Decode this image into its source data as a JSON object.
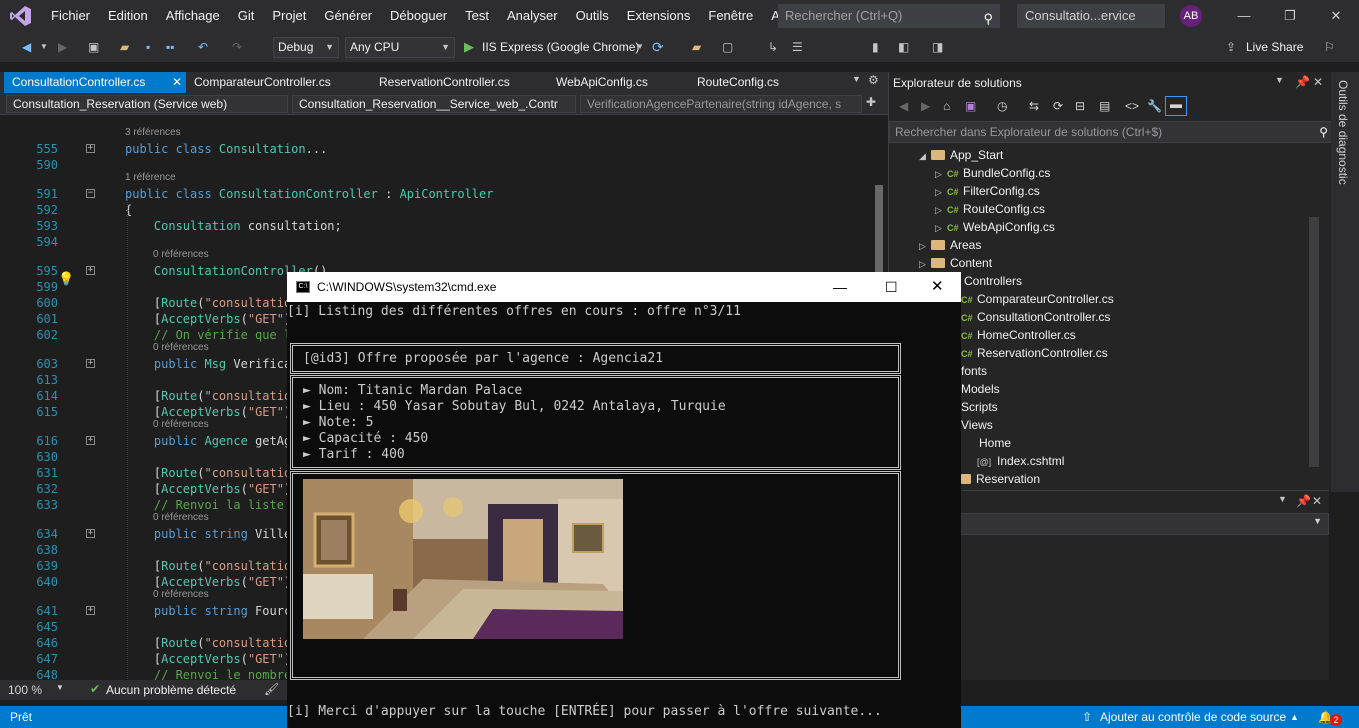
{
  "menubar": {
    "items": [
      "Fichier",
      "Edition",
      "Affichage",
      "Git",
      "Projet",
      "Générer",
      "Déboguer",
      "Test",
      "Analyser",
      "Outils",
      "Extensions",
      "Fenêtre",
      "Aide"
    ],
    "search_placeholder": "Rechercher (Ctrl+Q)",
    "window_title": "Consultatio...ervice web)",
    "avatar": "AB"
  },
  "toolbar": {
    "config": "Debug",
    "platform": "Any CPU",
    "run": "IIS Express (Google Chrome)",
    "live_share": "Live Share"
  },
  "tabs": [
    "ConsultationController.cs",
    "ComparateurController.cs",
    "ReservationController.cs",
    "WebApiConfig.cs",
    "RouteConfig.cs"
  ],
  "navbar": {
    "project": "Consultation_Reservation (Service web)",
    "class": "Consultation_Reservation__Service_web_.Contr",
    "member": "VerificationAgencePartenaire(string idAgence, s"
  },
  "editor": {
    "lines": [
      {
        "n": "555",
        "ref": "3 références",
        "code": [
          [
            "kw",
            "public class "
          ],
          [
            "ty",
            "Consultation"
          ],
          [
            "pl",
            "..."
          ]
        ]
      },
      {
        "n": "590",
        "code": []
      },
      {
        "n": "591",
        "ref": "1 référence",
        "code": [
          [
            "kw",
            "public class "
          ],
          [
            "ty",
            "ConsultationController"
          ],
          [
            "pl",
            " : "
          ],
          [
            "ty",
            "ApiController"
          ]
        ]
      },
      {
        "n": "592",
        "code": [
          [
            "pl",
            "{"
          ]
        ]
      },
      {
        "n": "593",
        "code": [
          [
            "pl",
            "    "
          ],
          [
            "ty",
            "Consultation"
          ],
          [
            "pl",
            " consultation;"
          ]
        ]
      },
      {
        "n": "594",
        "code": []
      },
      {
        "n": "595",
        "ref": "0 références",
        "code": [
          [
            "pl",
            "    "
          ],
          [
            "ty",
            "ConsultationController"
          ],
          [
            "pl",
            "()..."
          ]
        ]
      },
      {
        "n": "599",
        "code": []
      },
      {
        "n": "600",
        "code": [
          [
            "pl",
            "    ["
          ],
          [
            "ty",
            "Route"
          ],
          [
            "pl",
            "("
          ],
          [
            "st",
            "\"consultatio"
          ]
        ]
      },
      {
        "n": "601",
        "code": [
          [
            "pl",
            "    ["
          ],
          [
            "ty",
            "AcceptVerbs"
          ],
          [
            "pl",
            "("
          ],
          [
            "st",
            "\"GET\""
          ],
          [
            "pl",
            ")"
          ]
        ]
      },
      {
        "n": "602",
        "code": [
          [
            "cm",
            "    // On vérifie que l"
          ]
        ]
      },
      {
        "n": "603",
        "ref": "0 références",
        "code": [
          [
            "kw",
            "    public "
          ],
          [
            "ty",
            "Msg"
          ],
          [
            "pl",
            " Verificat"
          ]
        ]
      },
      {
        "n": "613",
        "code": []
      },
      {
        "n": "614",
        "code": [
          [
            "pl",
            "    ["
          ],
          [
            "ty",
            "Route"
          ],
          [
            "pl",
            "("
          ],
          [
            "st",
            "\"consultatio"
          ]
        ]
      },
      {
        "n": "615",
        "code": [
          [
            "pl",
            "    ["
          ],
          [
            "ty",
            "AcceptVerbs"
          ],
          [
            "pl",
            "("
          ],
          [
            "st",
            "\"GET\""
          ],
          [
            "pl",
            ")"
          ]
        ]
      },
      {
        "n": "616",
        "ref": "0 références",
        "code": [
          [
            "kw",
            "    public "
          ],
          [
            "ty",
            "Agence"
          ],
          [
            "pl",
            " getAg"
          ]
        ]
      },
      {
        "n": "630",
        "code": []
      },
      {
        "n": "631",
        "code": [
          [
            "pl",
            "    ["
          ],
          [
            "ty",
            "Route"
          ],
          [
            "pl",
            "("
          ],
          [
            "st",
            "\"consultatio"
          ]
        ]
      },
      {
        "n": "632",
        "code": [
          [
            "pl",
            "    ["
          ],
          [
            "ty",
            "AcceptVerbs"
          ],
          [
            "pl",
            "("
          ],
          [
            "st",
            "\"GET\""
          ],
          [
            "pl",
            ")"
          ]
        ]
      },
      {
        "n": "633",
        "code": [
          [
            "cm",
            "    // Renvoi la liste"
          ]
        ]
      },
      {
        "n": "634",
        "ref": "0 références",
        "code": [
          [
            "kw",
            "    public string "
          ],
          [
            "pl",
            "Ville"
          ]
        ]
      },
      {
        "n": "638",
        "code": []
      },
      {
        "n": "639",
        "code": [
          [
            "pl",
            "    ["
          ],
          [
            "ty",
            "Route"
          ],
          [
            "pl",
            "("
          ],
          [
            "st",
            "\"consultatio"
          ]
        ]
      },
      {
        "n": "640",
        "code": [
          [
            "pl",
            "    ["
          ],
          [
            "ty",
            "AcceptVerbs"
          ],
          [
            "pl",
            "("
          ],
          [
            "st",
            "\"GET\""
          ],
          [
            "pl",
            ")"
          ]
        ]
      },
      {
        "n": "641",
        "ref": "0 références",
        "code": [
          [
            "kw",
            "    public string "
          ],
          [
            "pl",
            "Fourc"
          ]
        ]
      },
      {
        "n": "645",
        "code": []
      },
      {
        "n": "646",
        "code": [
          [
            "pl",
            "    ["
          ],
          [
            "ty",
            "Route"
          ],
          [
            "pl",
            "("
          ],
          [
            "st",
            "\"consultatio"
          ]
        ]
      },
      {
        "n": "647",
        "code": [
          [
            "pl",
            "    ["
          ],
          [
            "ty",
            "AcceptVerbs"
          ],
          [
            "pl",
            "("
          ],
          [
            "st",
            "\"GET\""
          ],
          [
            "pl",
            ")"
          ]
        ]
      },
      {
        "n": "648",
        "code": [
          [
            "cm",
            "    // Renvoi le nombre"
          ]
        ]
      }
    ]
  },
  "editor_status": {
    "zoom": "100 %",
    "issues": "Aucun problème détecté"
  },
  "solution_explorer": {
    "title": "Explorateur de solutions",
    "search": "Rechercher dans Explorateur de solutions (Ctrl+$)",
    "items": [
      "App_Start",
      "BundleConfig.cs",
      "FilterConfig.cs",
      "RouteConfig.cs",
      "WebApiConfig.cs",
      "Areas",
      "Content",
      "Controllers",
      "ComparateurController.cs",
      "ConsultationController.cs",
      "HomeController.cs",
      "ReservationController.cs",
      "fonts",
      "Models",
      "Scripts",
      "Views",
      "Home",
      "Index.cshtml",
      "Reservation"
    ]
  },
  "side_tab": "Outils de diagnostic",
  "statusbar": {
    "left": "Prêt",
    "right": "Ajouter au contrôle de code source",
    "badge": "2"
  },
  "cmd": {
    "title": "C:\\WINDOWS\\system32\\cmd.exe",
    "header": "[i] Listing des différentes offres en cours : offre n°3/11",
    "offer_title": "[@id3] Offre proposée par l'agence : Agencia21",
    "details": [
      "► Nom: Titanic Mardan Palace",
      "► Lieu : 450 Yasar Sobutay Bul, 0242 Antalaya, Turquie",
      "► Note: 5",
      "► Capacité : 450",
      "► Tarif : 400"
    ],
    "footer": "[i] Merci d'appuyer sur la touche [ENTRÉE] pour passer à l'offre suivante..."
  }
}
